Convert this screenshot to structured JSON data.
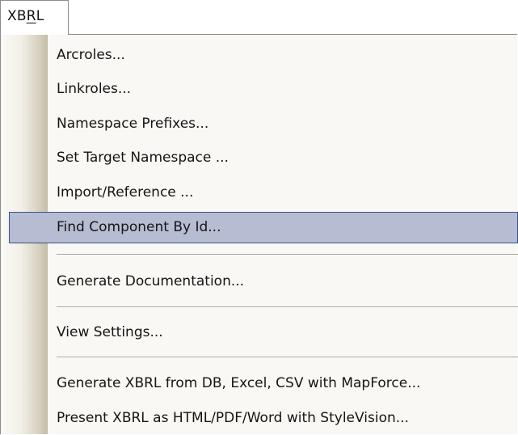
{
  "menu": {
    "title_prefix": "XB",
    "title_accel": "R",
    "title_suffix": "L"
  },
  "items": [
    {
      "label": "Arcroles..."
    },
    {
      "label": "Linkroles..."
    },
    {
      "label": "Namespace Prefixes..."
    },
    {
      "label": "Set Target Namespace ..."
    },
    {
      "label": "Import/Reference ..."
    },
    {
      "label": "Find Component By Id..."
    },
    {
      "label": "Generate Documentation..."
    },
    {
      "label": "View Settings..."
    },
    {
      "label": "Generate XBRL from DB, Excel, CSV with MapForce..."
    },
    {
      "label": "Present XBRL as HTML/PDF/Word with StyleVision..."
    }
  ],
  "highlighted_item": "Find Component By Id...",
  "colors": {
    "highlight_fill": "#b6bdd2",
    "highlight_border": "#3a4f8a",
    "menu_background": "#f9f8f4"
  }
}
